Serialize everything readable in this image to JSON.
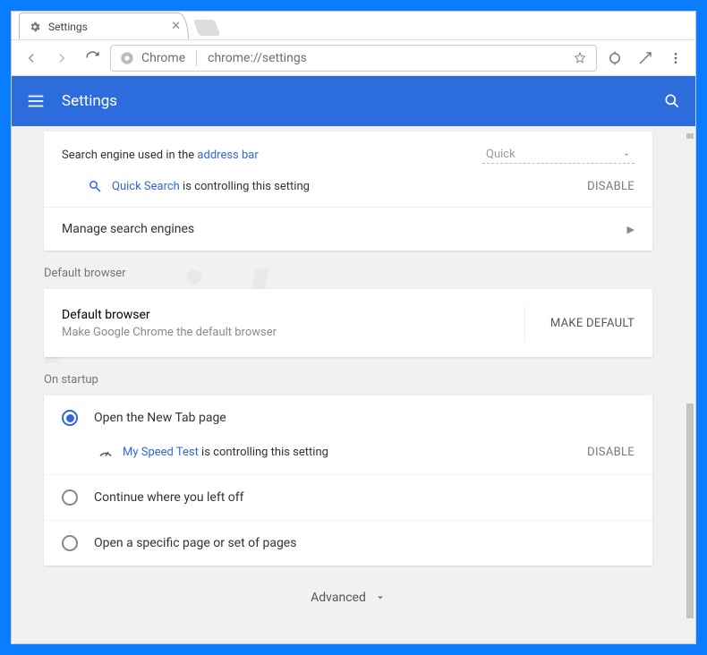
{
  "window": {
    "tab_title": "Settings",
    "omnibox_scheme_label": "Chrome",
    "omnibox_url": "chrome://settings"
  },
  "settings_bar": {
    "title": "Settings"
  },
  "search_engine": {
    "label_prefix": "Search engine used in the ",
    "label_link": "address bar",
    "selected": "Quick",
    "controlling_ext": "Quick Search",
    "controlling_suffix": " is controlling this setting",
    "disable_label": "DISABLE",
    "manage_label": "Manage search engines"
  },
  "default_browser": {
    "section_title": "Default browser",
    "title": "Default browser",
    "subtitle": "Make Google Chrome the default browser",
    "button": "MAKE DEFAULT"
  },
  "on_startup": {
    "section_title": "On startup",
    "options": [
      "Open the New Tab page",
      "Continue where you left off",
      "Open a specific page or set of pages"
    ],
    "selected_index": 0,
    "controlling_ext": "My Speed Test",
    "controlling_suffix": " is controlling this setting",
    "disable_label": "DISABLE"
  },
  "advanced_label": "Advanced",
  "watermark": "pcrisk.com"
}
